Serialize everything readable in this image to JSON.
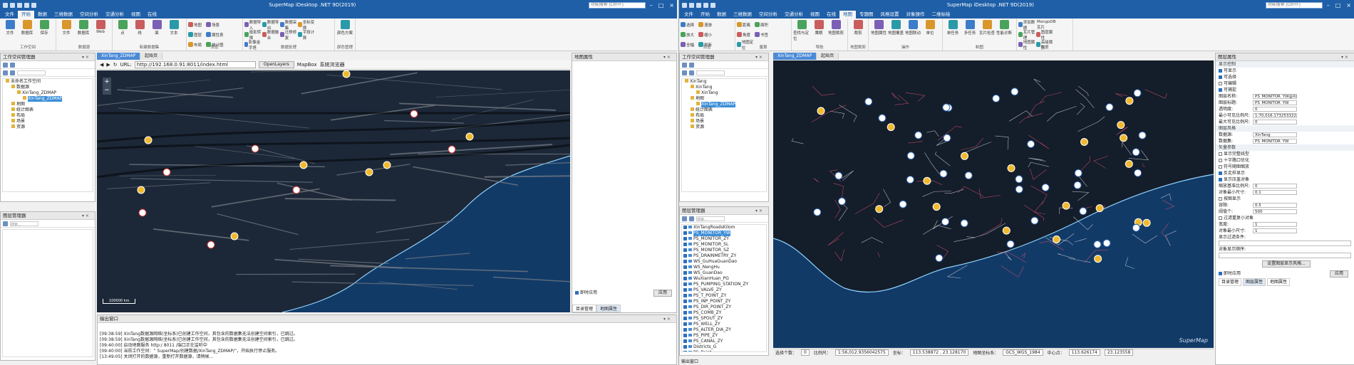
{
  "w1": {
    "title": "SuperMap iDesktop .NET 9D(2019)",
    "search_placeholder": "功能搜索 (Ctrl+F)",
    "menu": [
      "文件",
      "开始",
      "数据",
      "三维数据",
      "空间分析",
      "交通分析",
      "视图",
      "在线"
    ],
    "menu_active": 1,
    "ribbon_groups": [
      {
        "label": "工作空间",
        "btns": [
          "文件",
          "数据库",
          "保存"
        ]
      },
      {
        "label": "数据源",
        "btns": [
          "文件",
          "数据库",
          "Web"
        ]
      },
      {
        "label": "新建数据集",
        "btns": [
          "点",
          "线",
          "面",
          "文本"
        ]
      },
      {
        "label": "浏览",
        "btns": [
          "地图",
          "场景",
          "图层",
          "属性表",
          "布局",
          "统计图"
        ]
      },
      {
        "label": "数据处理",
        "btns": [
          "数据导入",
          "数据导出",
          "数据采集",
          "坐标变换",
          "投影转换",
          "数据融合",
          "迁移修复",
          "字段计算",
          "影像金字塔"
        ]
      },
      {
        "label": "颜色管理",
        "btns": [
          "颜色方案"
        ]
      }
    ],
    "workspace_panel": {
      "title": "工作空间管理器",
      "tree": [
        "未命名工作空间",
        "数据源",
        "XinTang_ZDMAP",
        "XinTang_ZDMAP",
        "地图",
        "统计图表",
        "布局",
        "场景",
        "资源"
      ]
    },
    "layer_panel": {
      "title": "图层管理器",
      "search": "搜索..."
    },
    "tabs": [
      "XinTang_ZDMAP",
      "起始页"
    ],
    "browser": {
      "url_label": "URL:",
      "url": "http://192.168.0.91:8011/index.html",
      "btns": [
        "OpenLayers",
        "MapBox",
        "系统浏览器"
      ]
    },
    "scale_text": "100000 km",
    "props_panel": {
      "title": "地图属性",
      "auto_apply": "即时应用",
      "apply_btn": "应用",
      "tabs": [
        "目录管理",
        "地图属性"
      ]
    },
    "output": {
      "title": "输出窗口",
      "lines": [
        "[09:38:59] XinTang数据源网络(坐标系)已创建工作空间，其包含的数据集无法创建空间索引，已跳过。",
        "[09:38:59] XinTang数据源网络(坐标系)已创建工作空间，其包含的数据集无法创建空间索引，已跳过。",
        "[09:40:00] 启动地图服务 http:/ 8011 /端口正在监听中",
        "[09:40:00] 当前工作空间：“ SuperMap/创建数据/XinTang_ZDMAP/”，开始执行停止服务。",
        "[13:49:05] 关闭打开的数据源，重新打开数据源，请稍候..."
      ]
    }
  },
  "w2": {
    "title": "SuperMap iDesktop .NET 9D(2019)",
    "search_placeholder": "功能搜索 (Ctrl+F)",
    "menu": [
      "文件",
      "开始",
      "数据",
      "三维数据",
      "空间分析",
      "交通分析",
      "视图",
      "在线",
      "地图",
      "专题图",
      "风格设置",
      "对象操作",
      "二维标绘"
    ],
    "menu_active": 8,
    "ribbon_groups": [
      {
        "label": "浏览",
        "btns": [
          "选择",
          "漫游",
          "放大",
          "缩小",
          "全幅",
          "刷新"
        ]
      },
      {
        "label": "量算",
        "btns": [
          "距离",
          "面积",
          "角度",
          "书签",
          "地图定位"
        ]
      },
      {
        "label": "导航",
        "btns": [
          "查找与定位",
          "鹰眼",
          "地图裁剪"
        ]
      },
      {
        "label": "地图裁剪",
        "btns": [
          "裁剪"
        ]
      },
      {
        "label": "操作",
        "btns": [
          "地图属性",
          "地图覆盖",
          "地图联动",
          "单位"
        ]
      },
      {
        "label": "制图",
        "btns": [
          "单任务",
          "多任务",
          "瓦片检查",
          "性能诊断"
        ]
      },
      {
        "label": "数据",
        "btns": [
          "添加数据",
          "MongoDB瓦片",
          "瓦片管理",
          "图层属性",
          "地图属性",
          "高级裁剪"
        ]
      }
    ],
    "workspace_panel": {
      "title": "工作空间管理器",
      "tree": [
        "XinTang",
        "XinTang",
        "XinTang",
        "地图",
        "XinTang_ZDMAP",
        "统计图表",
        "布局",
        "场景",
        "资源"
      ]
    },
    "layer_panel": {
      "title": "图层管理器",
      "search": "搜索...",
      "layers": [
        "XinTangRoadsKilom",
        "PS_MONITOR_YW",
        "PS_MONITOR_ZY",
        "PS_MONITOR_SL",
        "PS_MONITOR_SZ",
        "PS_DRAINMETRY_ZY",
        "WS_GuHuaGuanDao",
        "WS_NengHu",
        "WS_GuanDao",
        "WuXianHuan_PG",
        "PS_PUMPING_STATION_ZY",
        "PS_VALVE_ZY",
        "PS_T_POINT_ZY",
        "PS_INP_POINT_ZY",
        "PS_DIR_POINT_ZY",
        "PS_COMB_ZY",
        "PS_SPOUT_ZY",
        "PS_WELL_ZY",
        "PS_ALTER_DIA_ZY",
        "PS_PIPE_ZY",
        "PS_CANAL_ZY",
        "Districts_G",
        "PS_Point",
        "PS_SHP"
      ],
      "selected": 1
    },
    "tabs": [
      "XinTang_ZDMAP",
      "起始页"
    ],
    "watermark": "SuperMap",
    "status": {
      "sel_label": "选择个数：",
      "sel": "0",
      "scale_label": "比例尺：",
      "scale": "1:56,012.9356042575",
      "coord_label": "坐标：",
      "coord": "113.538872 , 23.128170",
      "sys_label": "地图坐标系：",
      "sys": "GCS_WGS_1984",
      "center_label": "中心点：",
      "cx": "113.626174",
      "cy": "23.123558"
    },
    "output_title": "输出窗口",
    "props_panel": {
      "title": "图层属性",
      "sections": [
        "显示控制",
        "图层风格",
        "矢量参数"
      ],
      "rows": [
        {
          "label": "图层名称:",
          "value": "PS_MONITOR_YW@XinTang"
        },
        {
          "label": "图层标题:",
          "value": "PS_MONITOR_YW"
        },
        {
          "label": "透明度:",
          "value": "0"
        },
        {
          "label": "最小可见比例尺:",
          "value": "1:70,016.1732533226"
        },
        {
          "label": "最大可见比例尺:",
          "value": "0"
        },
        {
          "label": "数据源:",
          "value": "XinTang"
        },
        {
          "label": "数据集:",
          "value": "PS_MONITOR_YW"
        },
        {
          "label": "缩放基准比例尺:",
          "value": "0"
        },
        {
          "label": "对象最小尺寸:",
          "value": "0.1"
        },
        {
          "label": "容限:",
          "value": "0.5"
        },
        {
          "label": "阈值个:",
          "value": "500"
        },
        {
          "label": "宽度:",
          "value": "1"
        },
        {
          "label": "对象最小尺寸:",
          "value": "1"
        }
      ],
      "checks": [
        "可显示",
        "可选择",
        "可编辑",
        "可捕捉",
        "显示完整线型",
        "十字路口优化",
        "符号随图缩放",
        "反走样显示",
        "显示压盖对象",
        "按图显示",
        "过滤重复小对象"
      ],
      "filter_label": "显示过滤条件:",
      "order_label": "对象显示顺序:",
      "sql_btn": "设置图层显示风格...",
      "auto_apply": "即时应用",
      "apply_btn": "应用",
      "tabs": [
        "目录管理",
        "图层属性",
        "地图属性"
      ]
    }
  },
  "colors": {
    "title_blue": "#1e5fa8",
    "map_bg": "#1c2838",
    "water": "#123a67",
    "coast": "#8fd3ff",
    "road": "#7a7f88",
    "pipe": "#d0506a"
  }
}
